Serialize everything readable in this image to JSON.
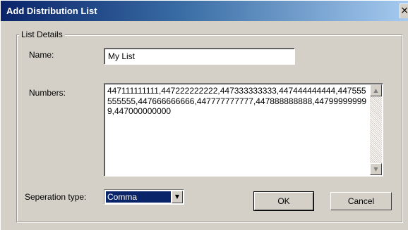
{
  "window": {
    "title": "Add Distribution List",
    "close_glyph": "×"
  },
  "group": {
    "legend": "List Details"
  },
  "name_field": {
    "label": "Name:",
    "value": "My List"
  },
  "numbers_field": {
    "label": "Numbers:",
    "value": "447111111111,447222222222,447333333333,447444444444,447555555555,447666666666,447777777777,447888888888,447999999999,447000000000"
  },
  "separation": {
    "label": "Seperation type:",
    "selected": "Comma"
  },
  "buttons": {
    "ok": "OK",
    "cancel": "Cancel"
  },
  "icons": {
    "scroll_up": "▲",
    "scroll_down": "▼",
    "dropdown": "▼"
  }
}
